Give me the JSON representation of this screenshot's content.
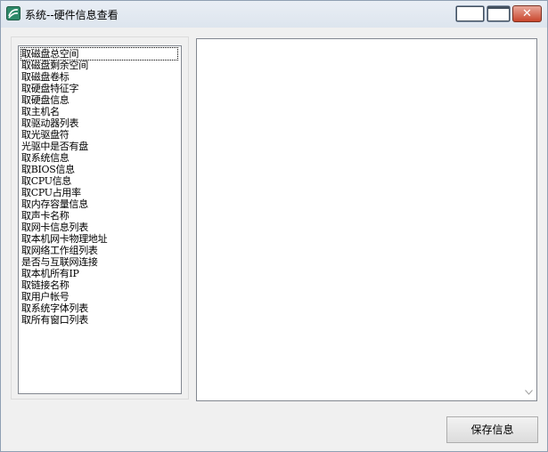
{
  "window": {
    "title": "系统--硬件信息查看",
    "close_glyph": "✕"
  },
  "list": {
    "selected_index": 0,
    "items": [
      "取磁盘总空间",
      "取磁盘剩余空间",
      "取磁盘卷标",
      "取硬盘特征字",
      "取硬盘信息",
      "取主机名",
      "取驱动器列表",
      "取光驱盘符",
      "光驱中是否有盘",
      "取系统信息",
      "取BIOS信息",
      "取CPU信息",
      "取CPU占用率",
      "取内存容量信息",
      "取声卡名称",
      "取网卡信息列表",
      "取本机网卡物理地址",
      "取网络工作组列表",
      "是否与互联网连接",
      "取本机所有IP",
      "取链接名称",
      "取用户帐号",
      "取系统字体列表",
      "取所有窗口列表"
    ]
  },
  "output": {
    "text": ""
  },
  "buttons": {
    "save_label": "保存信息"
  }
}
